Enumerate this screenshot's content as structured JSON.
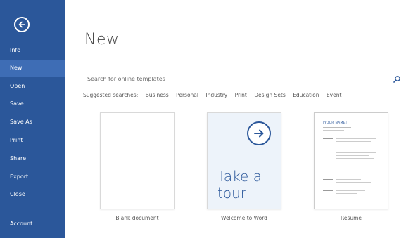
{
  "sidebar": {
    "items": [
      {
        "label": "Info"
      },
      {
        "label": "New"
      },
      {
        "label": "Open"
      },
      {
        "label": "Save"
      },
      {
        "label": "Save As"
      },
      {
        "label": "Print"
      },
      {
        "label": "Share"
      },
      {
        "label": "Export"
      },
      {
        "label": "Close"
      },
      {
        "label": "Account"
      }
    ],
    "active": "New",
    "back_icon": "back-arrow-icon"
  },
  "main": {
    "title": "New",
    "search": {
      "placeholder": "Search for online templates",
      "icon": "search-icon"
    },
    "suggested": {
      "label": "Suggested searches:",
      "items": [
        "Business",
        "Personal",
        "Industry",
        "Print",
        "Design Sets",
        "Education",
        "Event"
      ]
    },
    "templates": [
      {
        "caption": "Blank document"
      },
      {
        "caption": "Welcome to Word",
        "text": "Take a tour"
      },
      {
        "caption": "Resume",
        "name": "[YOUR NAME]"
      }
    ]
  },
  "colors": {
    "accent": "#2b579a",
    "active_item": "#3e6db5"
  }
}
